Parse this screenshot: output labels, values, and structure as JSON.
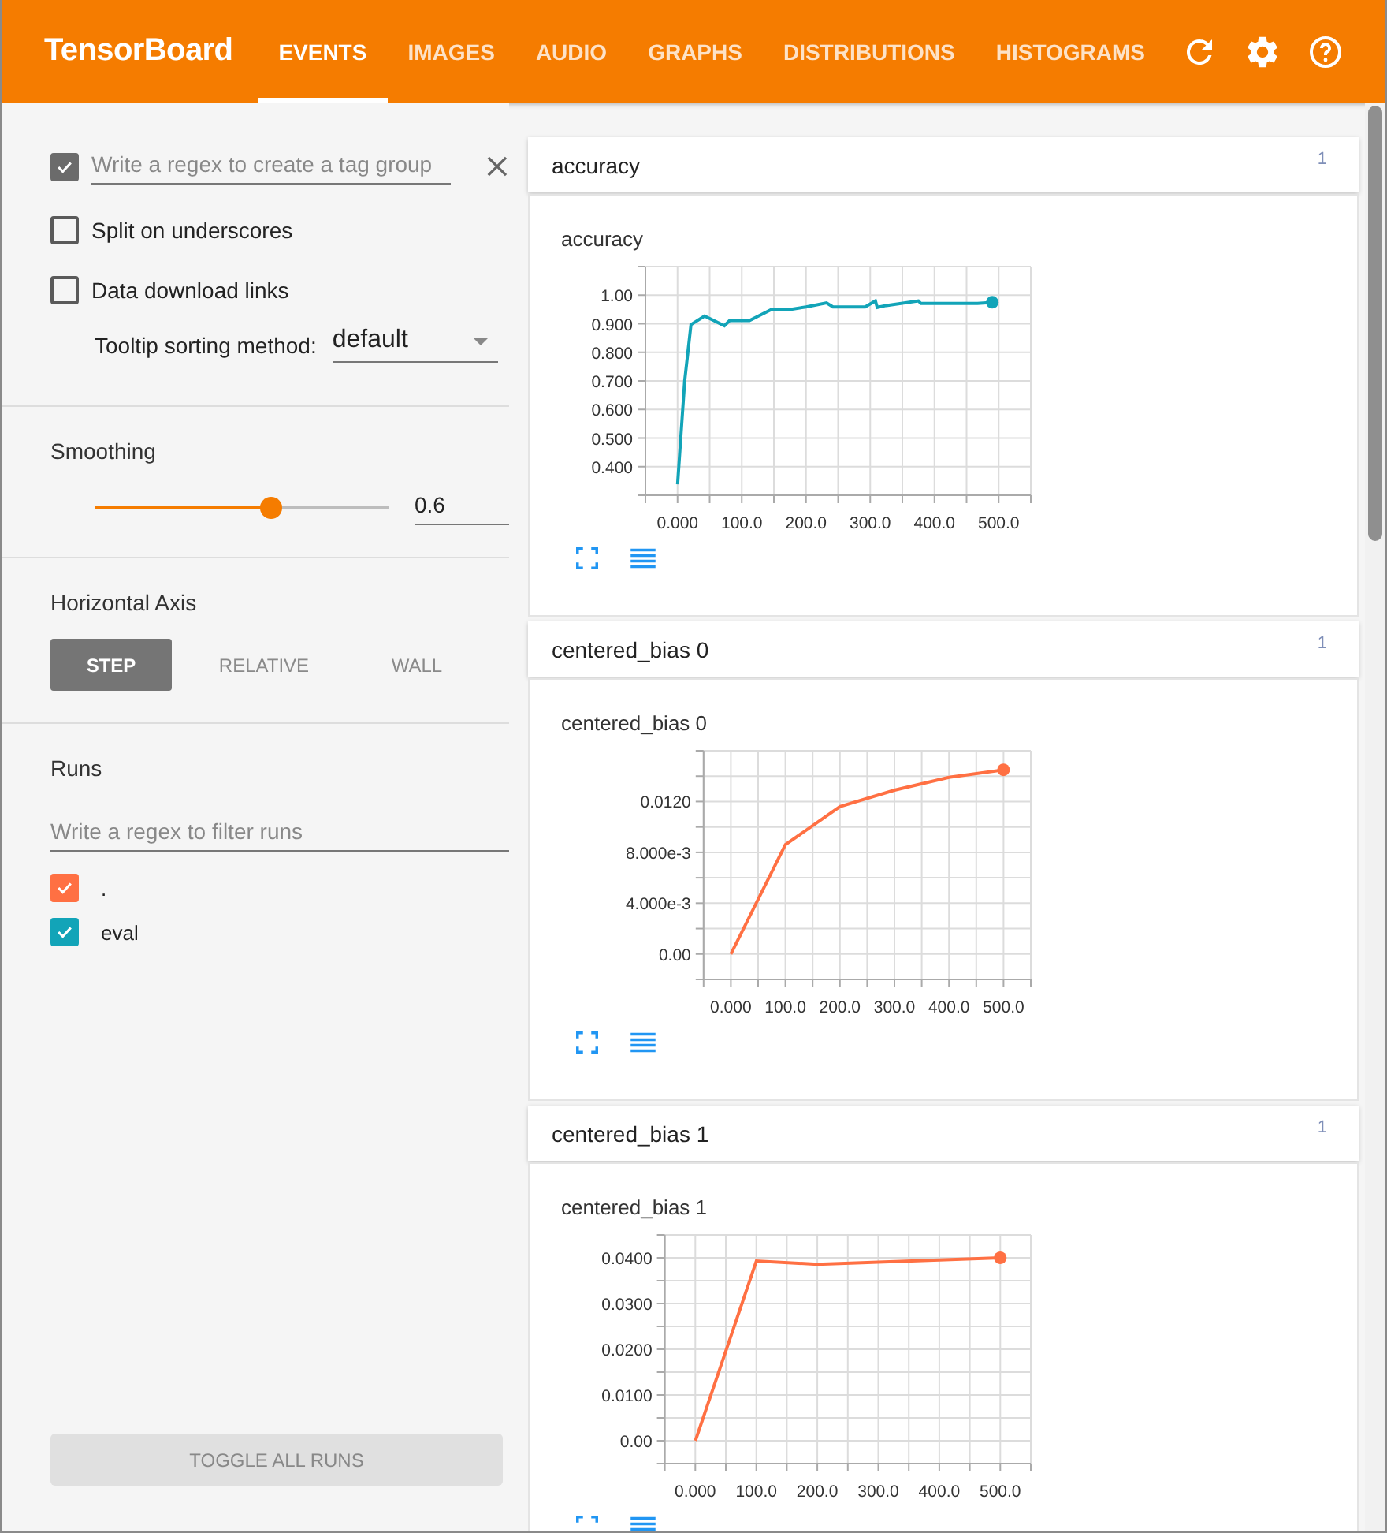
{
  "header": {
    "title": "TensorBoard",
    "tabs": [
      {
        "label": "EVENTS",
        "selected": true
      },
      {
        "label": "IMAGES",
        "selected": false
      },
      {
        "label": "AUDIO",
        "selected": false
      },
      {
        "label": "GRAPHS",
        "selected": false
      },
      {
        "label": "DISTRIBUTIONS",
        "selected": false
      },
      {
        "label": "HISTOGRAMS",
        "selected": false
      }
    ]
  },
  "sidebar": {
    "tag_group": {
      "checked": true,
      "placeholder": "Write a regex to create a tag group"
    },
    "options": [
      {
        "label": "Split on underscores",
        "checked": false
      },
      {
        "label": "Data download links",
        "checked": false
      }
    ],
    "tooltip_sorting": {
      "label": "Tooltip sorting method:",
      "value": "default"
    },
    "smoothing": {
      "label": "Smoothing",
      "level": 0.6,
      "value": "0.6"
    },
    "horizontal_axis": {
      "label": "Horizontal Axis",
      "options": [
        {
          "label": "STEP",
          "selected": true
        },
        {
          "label": "RELATIVE",
          "selected": false
        },
        {
          "label": "WALL",
          "selected": false
        }
      ]
    },
    "runs": {
      "label": "Runs",
      "placeholder": "Write a regex to filter runs",
      "items": [
        {
          "label": ".",
          "checked": true,
          "color": "#ff7043"
        },
        {
          "label": "eval",
          "checked": true,
          "color": "#12a4b8"
        }
      ]
    },
    "toggle_button": "TOGGLE ALL RUNS"
  },
  "cards": [
    {
      "title": "accuracy",
      "count": "1",
      "chart_data": {
        "type": "line",
        "title": "accuracy",
        "x": [
          0,
          11,
          21,
          42,
          73,
          81,
          112,
          146,
          175,
          200,
          232,
          242,
          292,
          308,
          311,
          325,
          375,
          379,
          467,
          490
        ],
        "series": [
          {
            "color": "#12a4b8",
            "values": [
              0.338,
              0.7,
              0.897,
              0.927,
              0.893,
              0.911,
              0.911,
              0.95,
              0.95,
              0.959,
              0.973,
              0.959,
              0.959,
              0.98,
              0.957,
              0.964,
              0.98,
              0.971,
              0.971,
              0.975
            ]
          }
        ],
        "grid": true,
        "xlim": [
          -50,
          550
        ],
        "ylim": [
          0.3,
          1.1
        ],
        "xticks": [
          {
            "value": 0,
            "label": "0.000"
          },
          {
            "value": 100,
            "label": "100.0"
          },
          {
            "value": 200,
            "label": "200.0"
          },
          {
            "value": 300,
            "label": "300.0"
          },
          {
            "value": 400,
            "label": "400.0"
          },
          {
            "value": 500,
            "label": "500.0"
          }
        ],
        "yticks": [
          {
            "value": 0.4,
            "label": "0.400"
          },
          {
            "value": 0.5,
            "label": "0.500"
          },
          {
            "value": 0.6,
            "label": "0.600"
          },
          {
            "value": 0.7,
            "label": "0.700"
          },
          {
            "value": 0.8,
            "label": "0.800"
          },
          {
            "value": 0.9,
            "label": "0.900"
          },
          {
            "value": 1,
            "label": "1.00"
          }
        ]
      }
    },
    {
      "title": "centered_bias 0",
      "count": "1",
      "chart_data": {
        "type": "line",
        "title": "centered_bias 0",
        "x": [
          0,
          100,
          200,
          300,
          400,
          500
        ],
        "series": [
          {
            "color": "#ff7043",
            "values": [
              0,
              0.0086,
              0.0116,
              0.0129,
              0.0139,
              0.0145
            ]
          }
        ],
        "grid": true,
        "xlim": [
          -50,
          550
        ],
        "ylim": [
          -0.002,
          0.016
        ],
        "xticks": [
          {
            "value": 0,
            "label": "0.000"
          },
          {
            "value": 100,
            "label": "100.0"
          },
          {
            "value": 200,
            "label": "200.0"
          },
          {
            "value": 300,
            "label": "300.0"
          },
          {
            "value": 400,
            "label": "400.0"
          },
          {
            "value": 500,
            "label": "500.0"
          }
        ],
        "yticks": [
          {
            "value": 0,
            "label": "0.00"
          },
          {
            "value": 0.004,
            "label": "4.000e-3"
          },
          {
            "value": 0.008,
            "label": "8.000e-3"
          },
          {
            "value": 0.012,
            "label": "0.0120"
          }
        ]
      }
    },
    {
      "title": "centered_bias 1",
      "count": "1",
      "chart_data": {
        "type": "line",
        "title": "centered_bias 1",
        "x": [
          0,
          100,
          200,
          500
        ],
        "series": [
          {
            "color": "#ff7043",
            "values": [
              0,
              0.0393,
              0.0386,
              0.04
            ]
          }
        ],
        "grid": true,
        "xlim": [
          -50,
          550
        ],
        "ylim": [
          -0.005,
          0.045
        ],
        "xticks": [
          {
            "value": 0,
            "label": "0.000"
          },
          {
            "value": 100,
            "label": "100.0"
          },
          {
            "value": 200,
            "label": "200.0"
          },
          {
            "value": 300,
            "label": "300.0"
          },
          {
            "value": 400,
            "label": "400.0"
          },
          {
            "value": 500,
            "label": "500.0"
          }
        ],
        "yticks": [
          {
            "value": 0,
            "label": "0.00"
          },
          {
            "value": 0.01,
            "label": "0.0100"
          },
          {
            "value": 0.02,
            "label": "0.0200"
          },
          {
            "value": 0.03,
            "label": "0.0300"
          },
          {
            "value": 0.04,
            "label": "0.0400"
          }
        ]
      }
    }
  ]
}
